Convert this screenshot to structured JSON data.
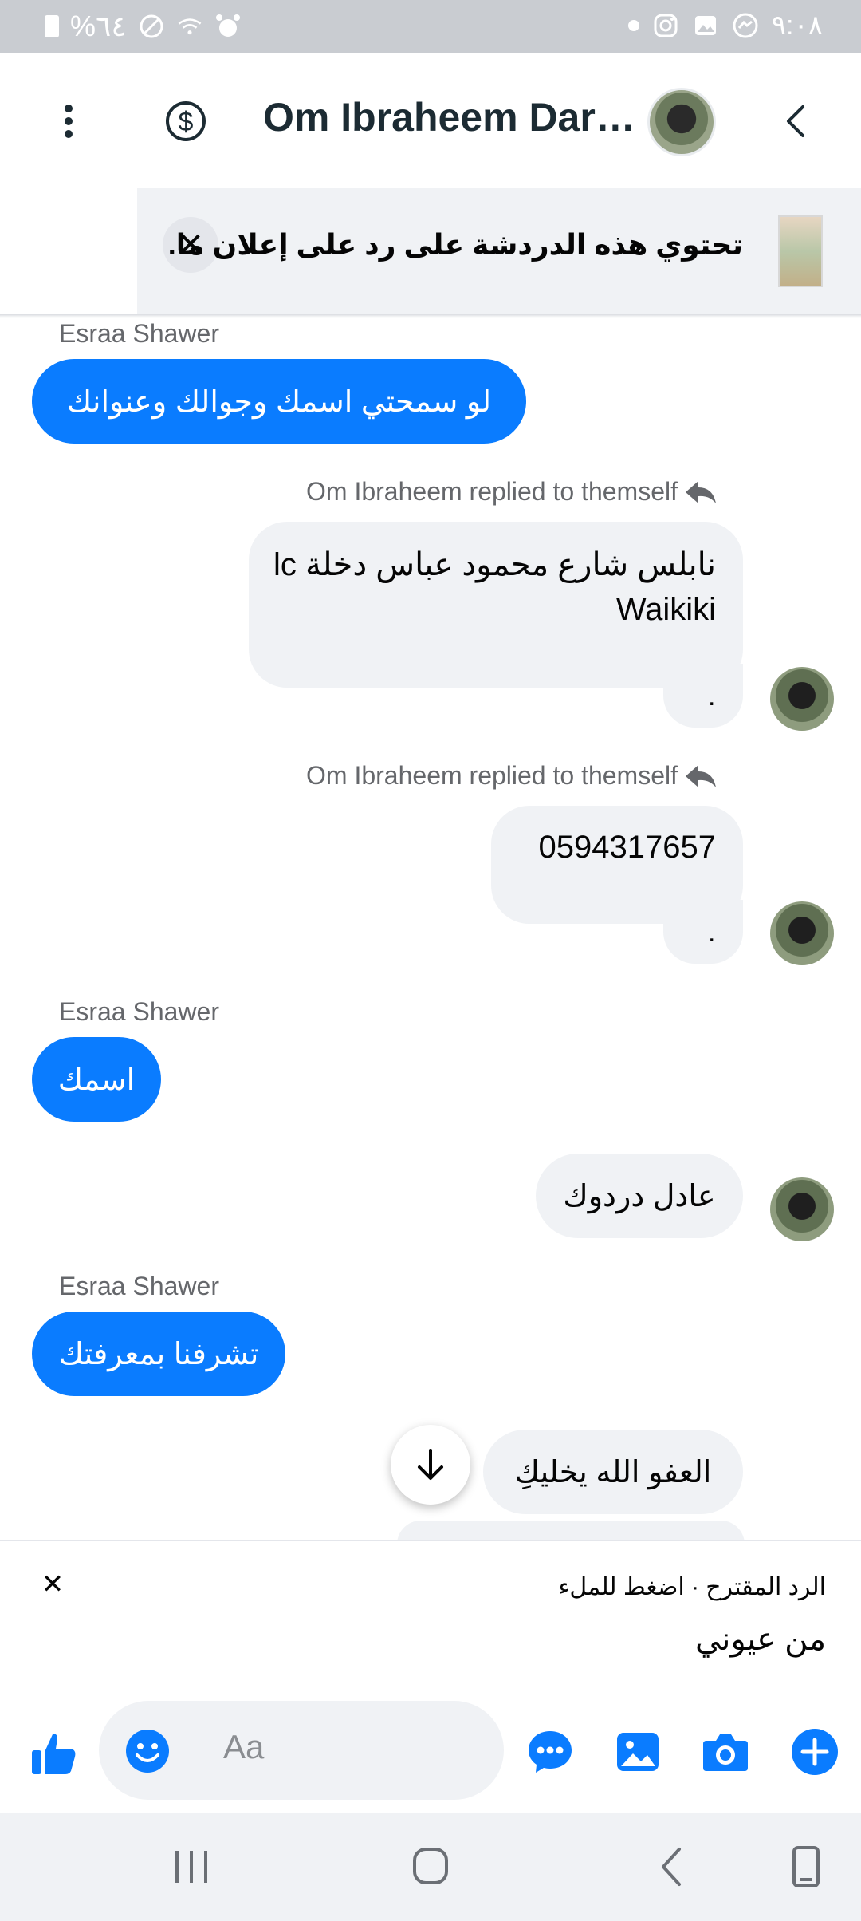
{
  "status_bar": {
    "battery": "%٦٤",
    "time": "٩:٠٨"
  },
  "header": {
    "title": "Om Ibraheem Dar…",
    "icons": [
      "more-vertical-icon",
      "dollar-icon",
      "avatar",
      "back-chevron-icon"
    ]
  },
  "banner": {
    "text": "تحتوي هذه الدردشة على رد على إعلان ما.",
    "close_label": "✕"
  },
  "messages": {
    "sender_name": "Esraa Shawer",
    "m1": "لو سمحتي اسمك وجوالك وعنوانك",
    "reply_label": "Om Ibraheem replied to themself",
    "m2_line1": "نابلس شارع محمود عباس دخلة lc",
    "m2_line2": "Waikiki",
    "m2_tail": ".",
    "m3": "0594317657",
    "m3_tail": ".",
    "m4": "اسمك",
    "m5": "عادل دردوك",
    "m6": "تشرفنا بمعرفتك",
    "m7": "العفو الله يخليكِ"
  },
  "suggested_reply": {
    "close_label": "✕",
    "hint": "الرد المقترح · اضغط للملء",
    "text": "من عيوني"
  },
  "composer": {
    "placeholder": "Aa",
    "icons": [
      "like-icon",
      "emoji-icon",
      "chat-bubble-icon",
      "gallery-icon",
      "camera-icon",
      "add-icon"
    ]
  },
  "colors": {
    "accent": "#0a7cff",
    "incoming_bubble": "#0a7cff",
    "outgoing_bubble": "#f0f2f5",
    "status_bar": "#c9ccd1"
  }
}
